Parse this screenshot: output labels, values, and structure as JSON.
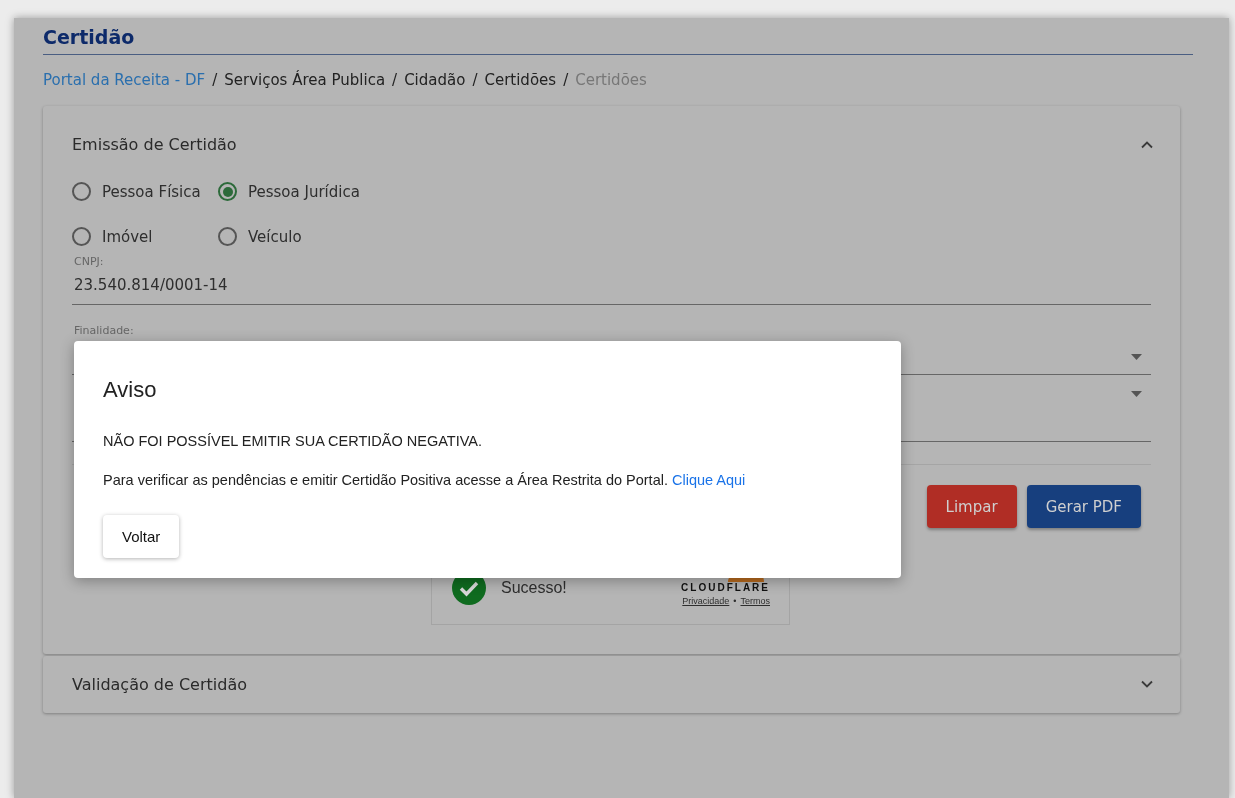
{
  "page_title": "Certidão",
  "breadcrumb_separator": "/",
  "breadcrumb": [
    {
      "label": "Portal da Receita - DF",
      "kind": "link"
    },
    {
      "label": "Serviços Área Publica",
      "kind": "item"
    },
    {
      "label": "Cidadão",
      "kind": "item"
    },
    {
      "label": "Certidões",
      "kind": "item"
    },
    {
      "label": "Certidões",
      "kind": "current"
    }
  ],
  "emission_panel": {
    "title": "Emissão de Certidão",
    "expanded": true,
    "person_types": [
      {
        "label": "Pessoa Física",
        "selected": false
      },
      {
        "label": "Pessoa Jurídica",
        "selected": true
      },
      {
        "label": "Imóvel",
        "selected": false
      },
      {
        "label": "Veículo",
        "selected": false
      }
    ],
    "cnpj": {
      "label": "CNPJ:",
      "value": "23.540.814/0001-14"
    },
    "finalidade": {
      "label": "Finalidade:"
    },
    "buttons": [
      {
        "label": "Limpar",
        "kind": "danger"
      },
      {
        "label": "Gerar PDF",
        "kind": "primary"
      }
    ],
    "captcha": {
      "status": "Sucesso!",
      "brand": "CLOUDFLARE",
      "links": [
        "Privacidade",
        "Termos"
      ],
      "link_separator": "•"
    }
  },
  "validation_panel": {
    "title": "Validação de Certidão",
    "expanded": false
  },
  "dialog": {
    "title": "Aviso",
    "message": "NÃO FOI POSSÍVEL EMITIR SUA CERTIDÃO NEGATIVA.",
    "detail": "Para verificar as pendências e emitir Certidão Positiva acesse a Área Restrita do Portal.",
    "link": "Clique Aqui",
    "button": "Voltar"
  }
}
